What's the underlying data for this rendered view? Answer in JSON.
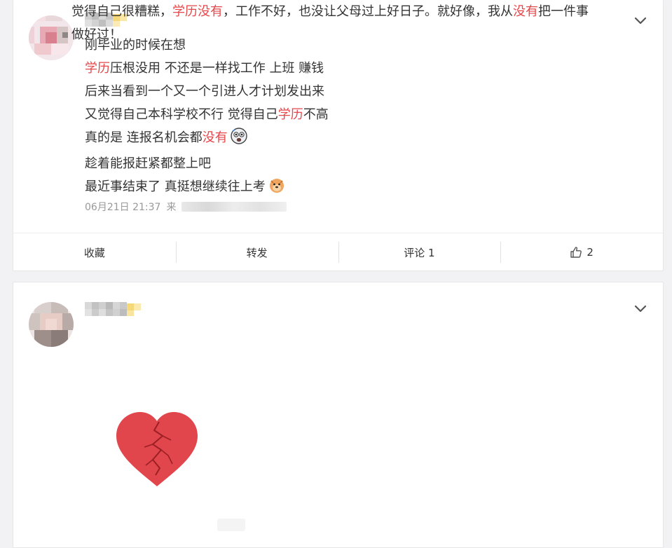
{
  "posts": [
    {
      "lines": [
        [
          {
            "t": "刚毕业的时候在想"
          }
        ],
        [
          {
            "t": "学历",
            "hl": true
          },
          {
            "t": "压根没用 不还是一样找工作 上班 赚钱"
          }
        ],
        [
          {
            "t": "后来当看到一个又一个引进人才计划发出来"
          }
        ],
        [
          {
            "t": "又觉得自己本科学校不行 觉得自己"
          },
          {
            "t": "学历",
            "hl": true
          },
          {
            "t": "不高"
          }
        ],
        [
          {
            "t": "真的是 连报名机会都"
          },
          {
            "t": "没有",
            "hl": true
          },
          {
            "emoji": "scared-face-emoji"
          }
        ],
        [
          {
            "t": "趁着能报赶紧都整上吧"
          }
        ],
        [
          {
            "t": "最近事结束了 真挺想继续往上考"
          },
          {
            "emoji": "doge-emoji"
          }
        ]
      ],
      "timestamp": "06月21日 21:37",
      "source_prefix": "来",
      "actions": {
        "collect": "收藏",
        "repost": "转发",
        "comment": "评论 1",
        "like_count": "2"
      }
    },
    {
      "lines": [
        [
          {
            "t": "觉得自己很糟糕，"
          },
          {
            "t": "学历没有",
            "hl": true
          },
          {
            "t": "，工作不好，也没让父母过上好日子。就好像，我从"
          },
          {
            "t": "没有",
            "hl": true
          },
          {
            "t": "把一件事"
          }
        ],
        [
          {
            "t": "做好过！"
          }
        ]
      ]
    }
  ],
  "colors": {
    "highlight": "#e5474b",
    "heart": "#e0464b",
    "crack": "#9c1f24"
  },
  "icons": {
    "menu": "chevron-down-icon",
    "like": "thumbs-up-icon"
  }
}
